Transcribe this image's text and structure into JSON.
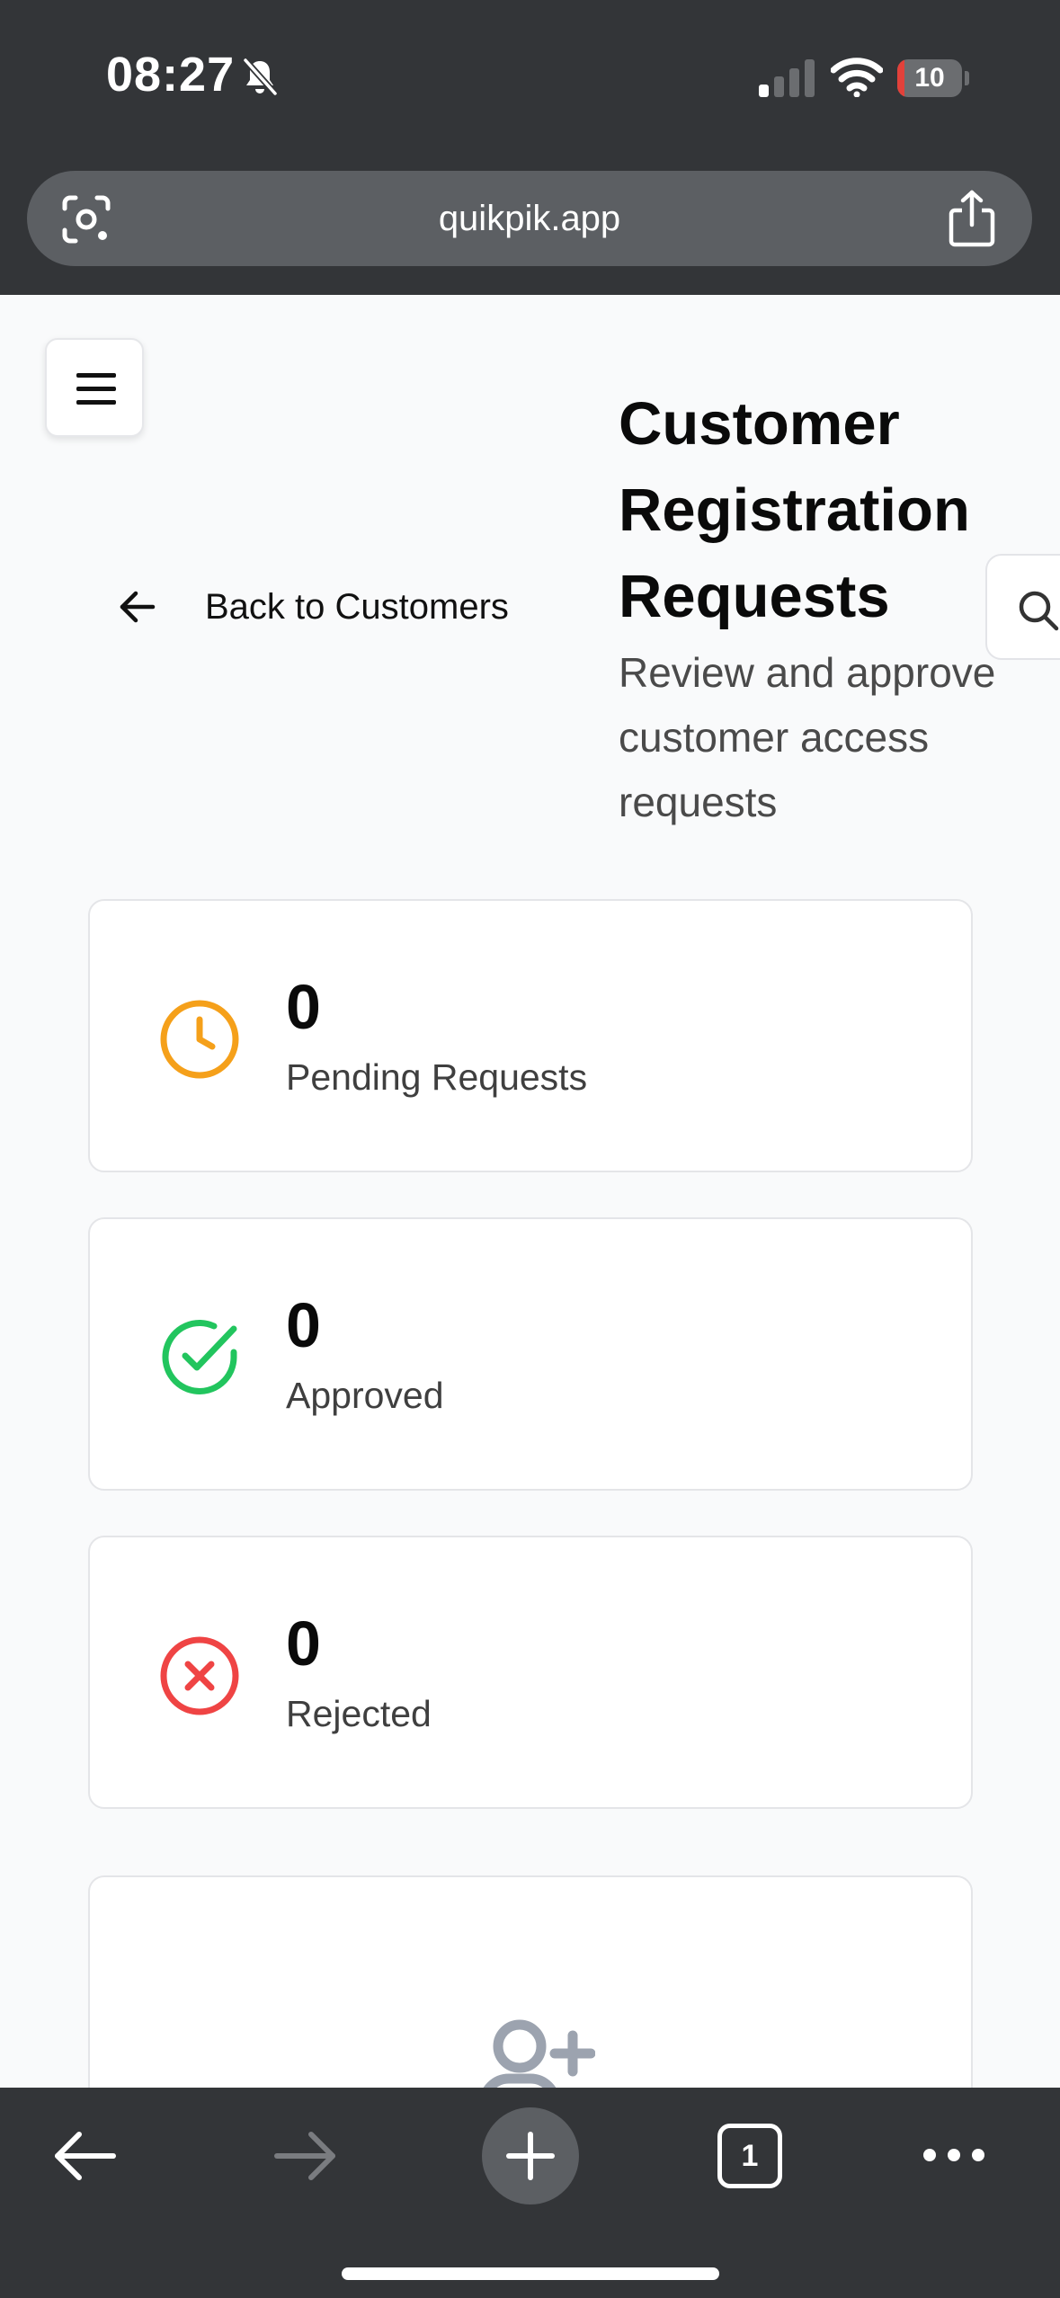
{
  "status_bar": {
    "time": "08:27",
    "battery_level": "10",
    "battery_fraction": 0.1
  },
  "browser": {
    "url": "quikpik.app",
    "tab_count": "1"
  },
  "page": {
    "back_label": "Back to Customers",
    "title": "Customer Registration Requests",
    "subtitle": "Review and approve customer access requests"
  },
  "stats": [
    {
      "value": "0",
      "label": "Pending Requests",
      "icon": "clock-icon",
      "color": "#f5a01a"
    },
    {
      "value": "0",
      "label": "Approved",
      "icon": "check-circle-icon",
      "color": "#22c55e"
    },
    {
      "value": "0",
      "label": "Rejected",
      "icon": "x-circle-icon",
      "color": "#ef4444"
    }
  ],
  "empty_state": {
    "icon": "user-plus-icon",
    "icon_color": "#9ca3af"
  },
  "colors": {
    "chrome": "#333538",
    "url_bar": "#5c5f63",
    "page_background": "#f9fafb"
  }
}
